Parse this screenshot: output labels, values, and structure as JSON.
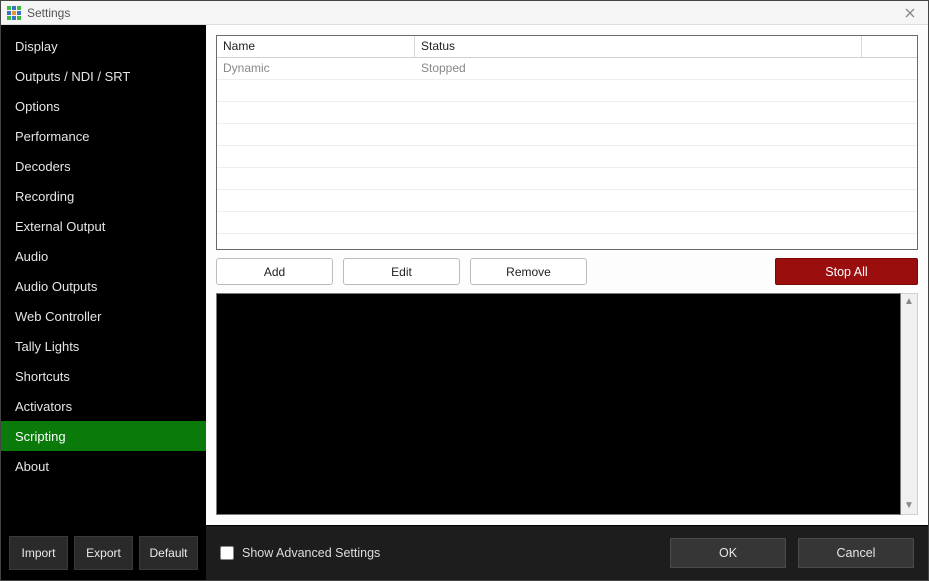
{
  "window": {
    "title": "Settings"
  },
  "sidebar": {
    "items": [
      {
        "label": "Display",
        "active": false
      },
      {
        "label": "Outputs / NDI / SRT",
        "active": false
      },
      {
        "label": "Options",
        "active": false
      },
      {
        "label": "Performance",
        "active": false
      },
      {
        "label": "Decoders",
        "active": false
      },
      {
        "label": "Recording",
        "active": false
      },
      {
        "label": "External Output",
        "active": false
      },
      {
        "label": "Audio",
        "active": false
      },
      {
        "label": "Audio Outputs",
        "active": false
      },
      {
        "label": "Web Controller",
        "active": false
      },
      {
        "label": "Tally Lights",
        "active": false
      },
      {
        "label": "Shortcuts",
        "active": false
      },
      {
        "label": "Activators",
        "active": false
      },
      {
        "label": "Scripting",
        "active": true
      },
      {
        "label": "About",
        "active": false
      }
    ],
    "import_label": "Import",
    "export_label": "Export",
    "default_label": "Default"
  },
  "table": {
    "headers": {
      "name": "Name",
      "status": "Status"
    },
    "rows": [
      {
        "name": "Dynamic",
        "status": "Stopped"
      }
    ]
  },
  "buttons": {
    "add": "Add",
    "edit": "Edit",
    "remove": "Remove",
    "stop_all": "Stop All"
  },
  "footer": {
    "advanced_label": "Show Advanced Settings",
    "ok": "OK",
    "cancel": "Cancel"
  }
}
